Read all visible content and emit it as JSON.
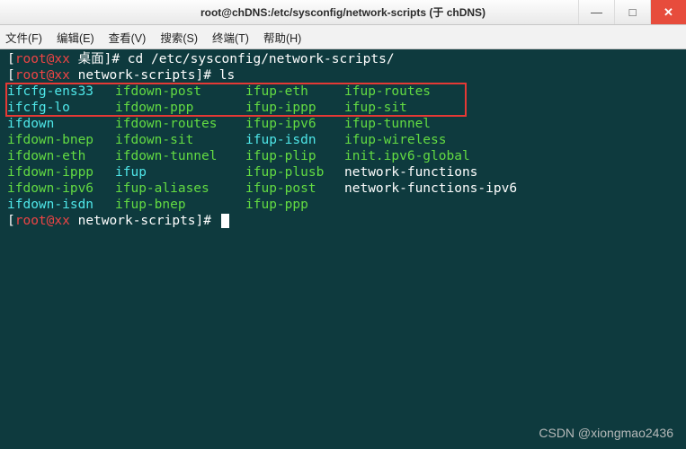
{
  "window": {
    "title": "root@chDNS:/etc/sysconfig/network-scripts (于 chDNS)"
  },
  "menu": {
    "file": "文件(F)",
    "edit": "编辑(E)",
    "view": "查看(V)",
    "search": "搜索(S)",
    "terminal": "终端(T)",
    "help": "帮助(H)"
  },
  "prompt1": {
    "open": "[",
    "user": "root",
    "at": "@",
    "host": "xx",
    "space": " ",
    "path": "桌面",
    "close": "]",
    "hash": "#",
    "cmd": " cd /etc/sysconfig/network-scripts/"
  },
  "prompt2": {
    "open": "[",
    "user": "root",
    "at": "@",
    "host": "xx",
    "space": " ",
    "path": "network-scripts",
    "close": "]",
    "hash": "#",
    "cmd": " ls"
  },
  "rows": [
    {
      "c1": {
        "t": "ifcfg-ens33",
        "k": "cyan"
      },
      "c2": {
        "t": "ifdown-post",
        "k": "green"
      },
      "c3": {
        "t": "ifup-eth",
        "k": "green"
      },
      "c4": {
        "t": "ifup-routes",
        "k": "green"
      }
    },
    {
      "c1": {
        "t": "ifcfg-lo",
        "k": "cyan"
      },
      "c2": {
        "t": "ifdown-ppp",
        "k": "green"
      },
      "c3": {
        "t": "ifup-ippp",
        "k": "green"
      },
      "c4": {
        "t": "ifup-sit",
        "k": "green"
      }
    },
    {
      "c1": {
        "t": "ifdown",
        "k": "cyan"
      },
      "c2": {
        "t": "ifdown-routes",
        "k": "green"
      },
      "c3": {
        "t": "ifup-ipv6",
        "k": "green"
      },
      "c4": {
        "t": "ifup-tunnel",
        "k": "green"
      }
    },
    {
      "c1": {
        "t": "ifdown-bnep",
        "k": "green"
      },
      "c2": {
        "t": "ifdown-sit",
        "k": "green"
      },
      "c3": {
        "t": "ifup-isdn",
        "k": "cyan"
      },
      "c4": {
        "t": "ifup-wireless",
        "k": "green"
      }
    },
    {
      "c1": {
        "t": "ifdown-eth",
        "k": "green"
      },
      "c2": {
        "t": "ifdown-tunnel",
        "k": "green"
      },
      "c3": {
        "t": "ifup-plip",
        "k": "green"
      },
      "c4": {
        "t": "init.ipv6-global",
        "k": "green"
      }
    },
    {
      "c1": {
        "t": "ifdown-ippp",
        "k": "green"
      },
      "c2": {
        "t": "ifup",
        "k": "cyan"
      },
      "c3": {
        "t": "ifup-plusb",
        "k": "green"
      },
      "c4": {
        "t": "network-functions",
        "k": "white"
      }
    },
    {
      "c1": {
        "t": "ifdown-ipv6",
        "k": "green"
      },
      "c2": {
        "t": "ifup-aliases",
        "k": "green"
      },
      "c3": {
        "t": "ifup-post",
        "k": "green"
      },
      "c4": {
        "t": "network-functions-ipv6",
        "k": "white"
      }
    },
    {
      "c1": {
        "t": "ifdown-isdn",
        "k": "cyan"
      },
      "c2": {
        "t": "ifup-bnep",
        "k": "green"
      },
      "c3": {
        "t": "ifup-ppp",
        "k": "green"
      },
      "c4": {
        "t": "",
        "k": "white"
      }
    }
  ],
  "prompt3": {
    "open": "[",
    "user": "root",
    "at": "@",
    "host": "xx",
    "space": " ",
    "path": "network-scripts",
    "close": "]",
    "hash": "#",
    "cmd": " "
  },
  "watermark": "CSDN @xiongmao2436",
  "win_controls": {
    "min": "—",
    "max": "□",
    "close": "✕"
  }
}
